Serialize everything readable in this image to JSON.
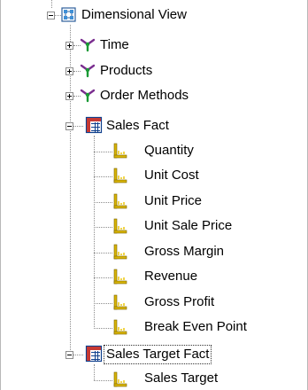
{
  "tree": {
    "root": {
      "label": "Dimensional View",
      "icon": "dimensional-view-icon",
      "expanded": true
    },
    "dimensions": [
      {
        "label": "Time",
        "icon": "dimension-icon",
        "expanded": false
      },
      {
        "label": "Products",
        "icon": "dimension-icon",
        "expanded": false
      },
      {
        "label": "Order Methods",
        "icon": "dimension-icon",
        "expanded": false
      }
    ],
    "facts": [
      {
        "label": "Sales Fact",
        "icon": "fact-table-icon",
        "expanded": true,
        "measures": [
          "Quantity",
          "Unit Cost",
          "Unit Price",
          "Unit Sale Price",
          "Gross Margin",
          "Revenue",
          "Gross Profit",
          "Break Even Point"
        ]
      },
      {
        "label": "Sales Target Fact",
        "icon": "fact-table-icon",
        "expanded": true,
        "focused": true,
        "measures": [
          "Sales Target"
        ]
      }
    ],
    "measure_icon": "measure-icon"
  },
  "colors": {
    "background": "#ffffff",
    "tree_lines": "#8c8c8c",
    "text": "#000000",
    "dimension_green": "#1a9a35",
    "dimension_purple": "#7a2e8f",
    "measure_yellow": "#d8b400",
    "fact_blue": "#0f3f8c",
    "fact_red": "#c73a34"
  }
}
